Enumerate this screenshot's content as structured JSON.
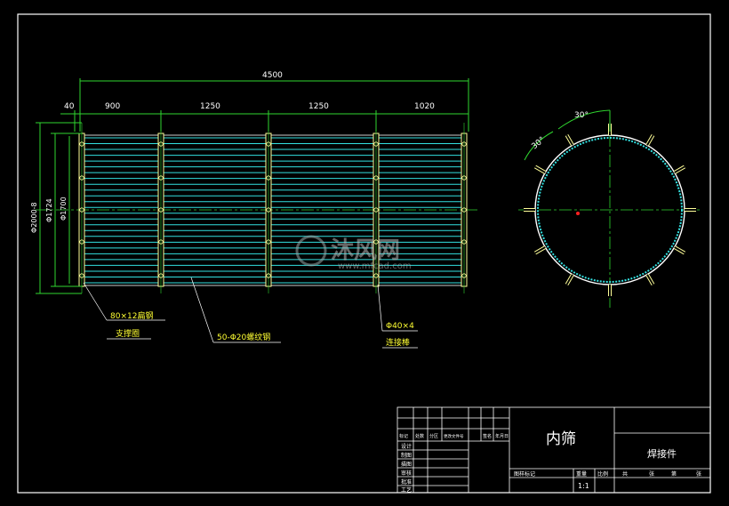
{
  "dimensions": {
    "total_length": "4500",
    "seg_40": "40",
    "seg_900": "900",
    "seg_1250_a": "1250",
    "seg_1250_b": "1250",
    "seg_1020": "1020",
    "dia_outer": "Φ2000-8",
    "dia_mid": "Φ1724",
    "dia_inner": "Φ1700",
    "angle_top": "30°",
    "angle_side": "30°"
  },
  "callouts": {
    "support_ring_spec": "80×12扁钢",
    "support_ring_name": "支撑圈",
    "rebar_spec": "50-Φ20螺纹钢",
    "connecting_rod_spec": "Φ40×4",
    "connecting_rod_name": "连接棒"
  },
  "watermark": {
    "brand": "沐风网",
    "url": "www.mfcad.com"
  },
  "title_block": {
    "part_name": "内筛",
    "drawing_type": "焊接件",
    "scale": "1:1",
    "header_cells": [
      "标记",
      "处数",
      "分区",
      "更改文件号",
      "签名",
      "年月日"
    ],
    "role_labels": [
      "设计",
      "制图",
      "描图",
      "审核",
      "批准",
      "工艺"
    ],
    "stage_labels": [
      "图样标记",
      "重量",
      "比例"
    ],
    "sheet_labels": [
      "共",
      "张",
      "第",
      "张"
    ]
  },
  "colors": {
    "background": "#000000",
    "frame": "#ffffff",
    "dimension": "#2fd62f",
    "rebar": "#33e0e0",
    "part": "#ffff99",
    "callout_text": "#ffff33"
  }
}
